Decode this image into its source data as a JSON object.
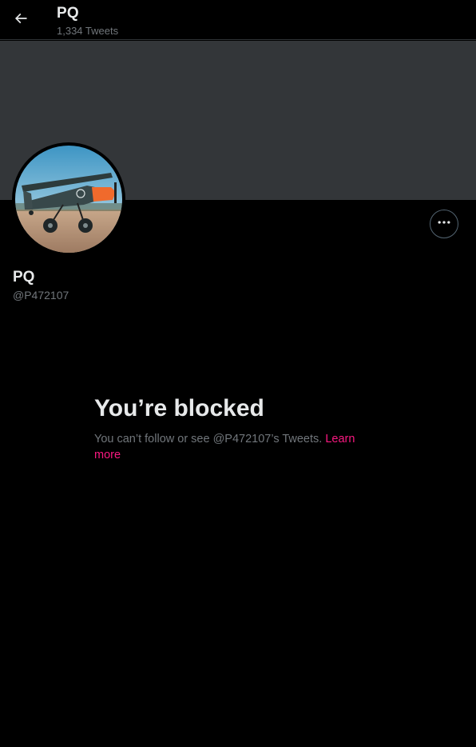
{
  "header": {
    "title": "PQ",
    "tweet_count": "1,334 Tweets"
  },
  "icons": {
    "back": "arrow-left-icon",
    "more": "more-horizontal-icon"
  },
  "profile": {
    "name": "PQ",
    "handle": "@P472107"
  },
  "blocked": {
    "title": "You’re blocked",
    "message": "You can’t follow or see @P472107’s Tweets.",
    "link_label": "Learn more"
  },
  "colors": {
    "background": "#000000",
    "banner": "#333639",
    "text_primary": "#e7e9ea",
    "text_secondary": "#71767b",
    "link": "#f91880"
  }
}
